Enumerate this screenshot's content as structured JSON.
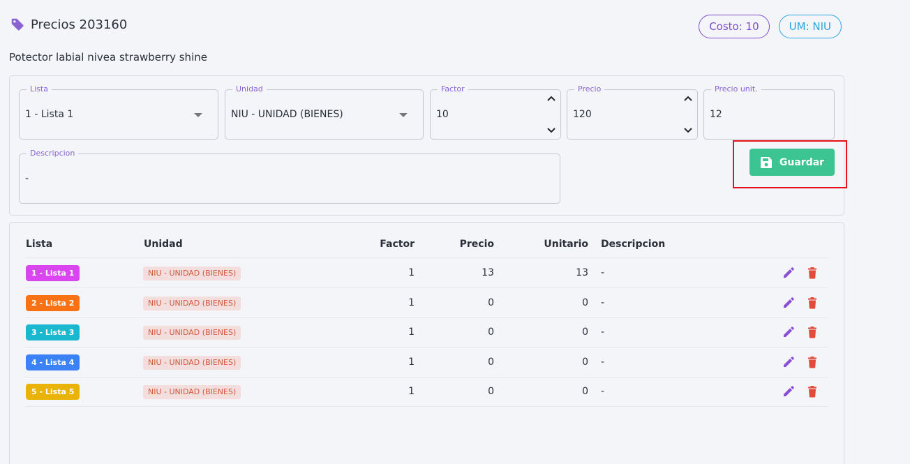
{
  "header": {
    "title": "Precios 203160",
    "icon": "tag-icon"
  },
  "chips": {
    "costo": "Costo: 10",
    "um": "UM: NIU"
  },
  "subtitle": "Potector labial nivea strawberry shine",
  "form": {
    "lista": {
      "label": "Lista",
      "value": "1 - Lista 1"
    },
    "unidad": {
      "label": "Unidad",
      "value": "NIU - UNIDAD (BIENES)"
    },
    "factor": {
      "label": "Factor",
      "value": "10"
    },
    "precio": {
      "label": "Precio",
      "value": "120"
    },
    "precio_unit": {
      "label": "Precio unit.",
      "value": "12"
    },
    "descripcion": {
      "label": "Descripcion",
      "value": "-"
    },
    "save_label": "Guardar"
  },
  "table": {
    "headers": {
      "lista": "Lista",
      "unidad": "Unidad",
      "factor": "Factor",
      "precio": "Precio",
      "unitario": "Unitario",
      "descripcion": "Descripcion"
    },
    "rows": [
      {
        "lista": "1 - Lista 1",
        "color": "#d946ef",
        "unidad": "NIU - UNIDAD (BIENES)",
        "factor": "1",
        "precio": "13",
        "unitario": "13",
        "descripcion": "-"
      },
      {
        "lista": "2 - Lista 2",
        "color": "#f97316",
        "unidad": "NIU - UNIDAD (BIENES)",
        "factor": "1",
        "precio": "0",
        "unitario": "0",
        "descripcion": "-"
      },
      {
        "lista": "3 - Lista 3",
        "color": "#1ab8cf",
        "unidad": "NIU - UNIDAD (BIENES)",
        "factor": "1",
        "precio": "0",
        "unitario": "0",
        "descripcion": "-"
      },
      {
        "lista": "4 - Lista 4",
        "color": "#3b82f6",
        "unidad": "NIU - UNIDAD (BIENES)",
        "factor": "1",
        "precio": "0",
        "unitario": "0",
        "descripcion": "-"
      },
      {
        "lista": "5 - Lista 5",
        "color": "#eab308",
        "unidad": "NIU - UNIDAD (BIENES)",
        "factor": "1",
        "precio": "0",
        "unitario": "0",
        "descripcion": "-"
      }
    ]
  },
  "colors": {
    "accent": "#8a63d2",
    "save": "#3cc592",
    "delete": "#e24b3b"
  }
}
